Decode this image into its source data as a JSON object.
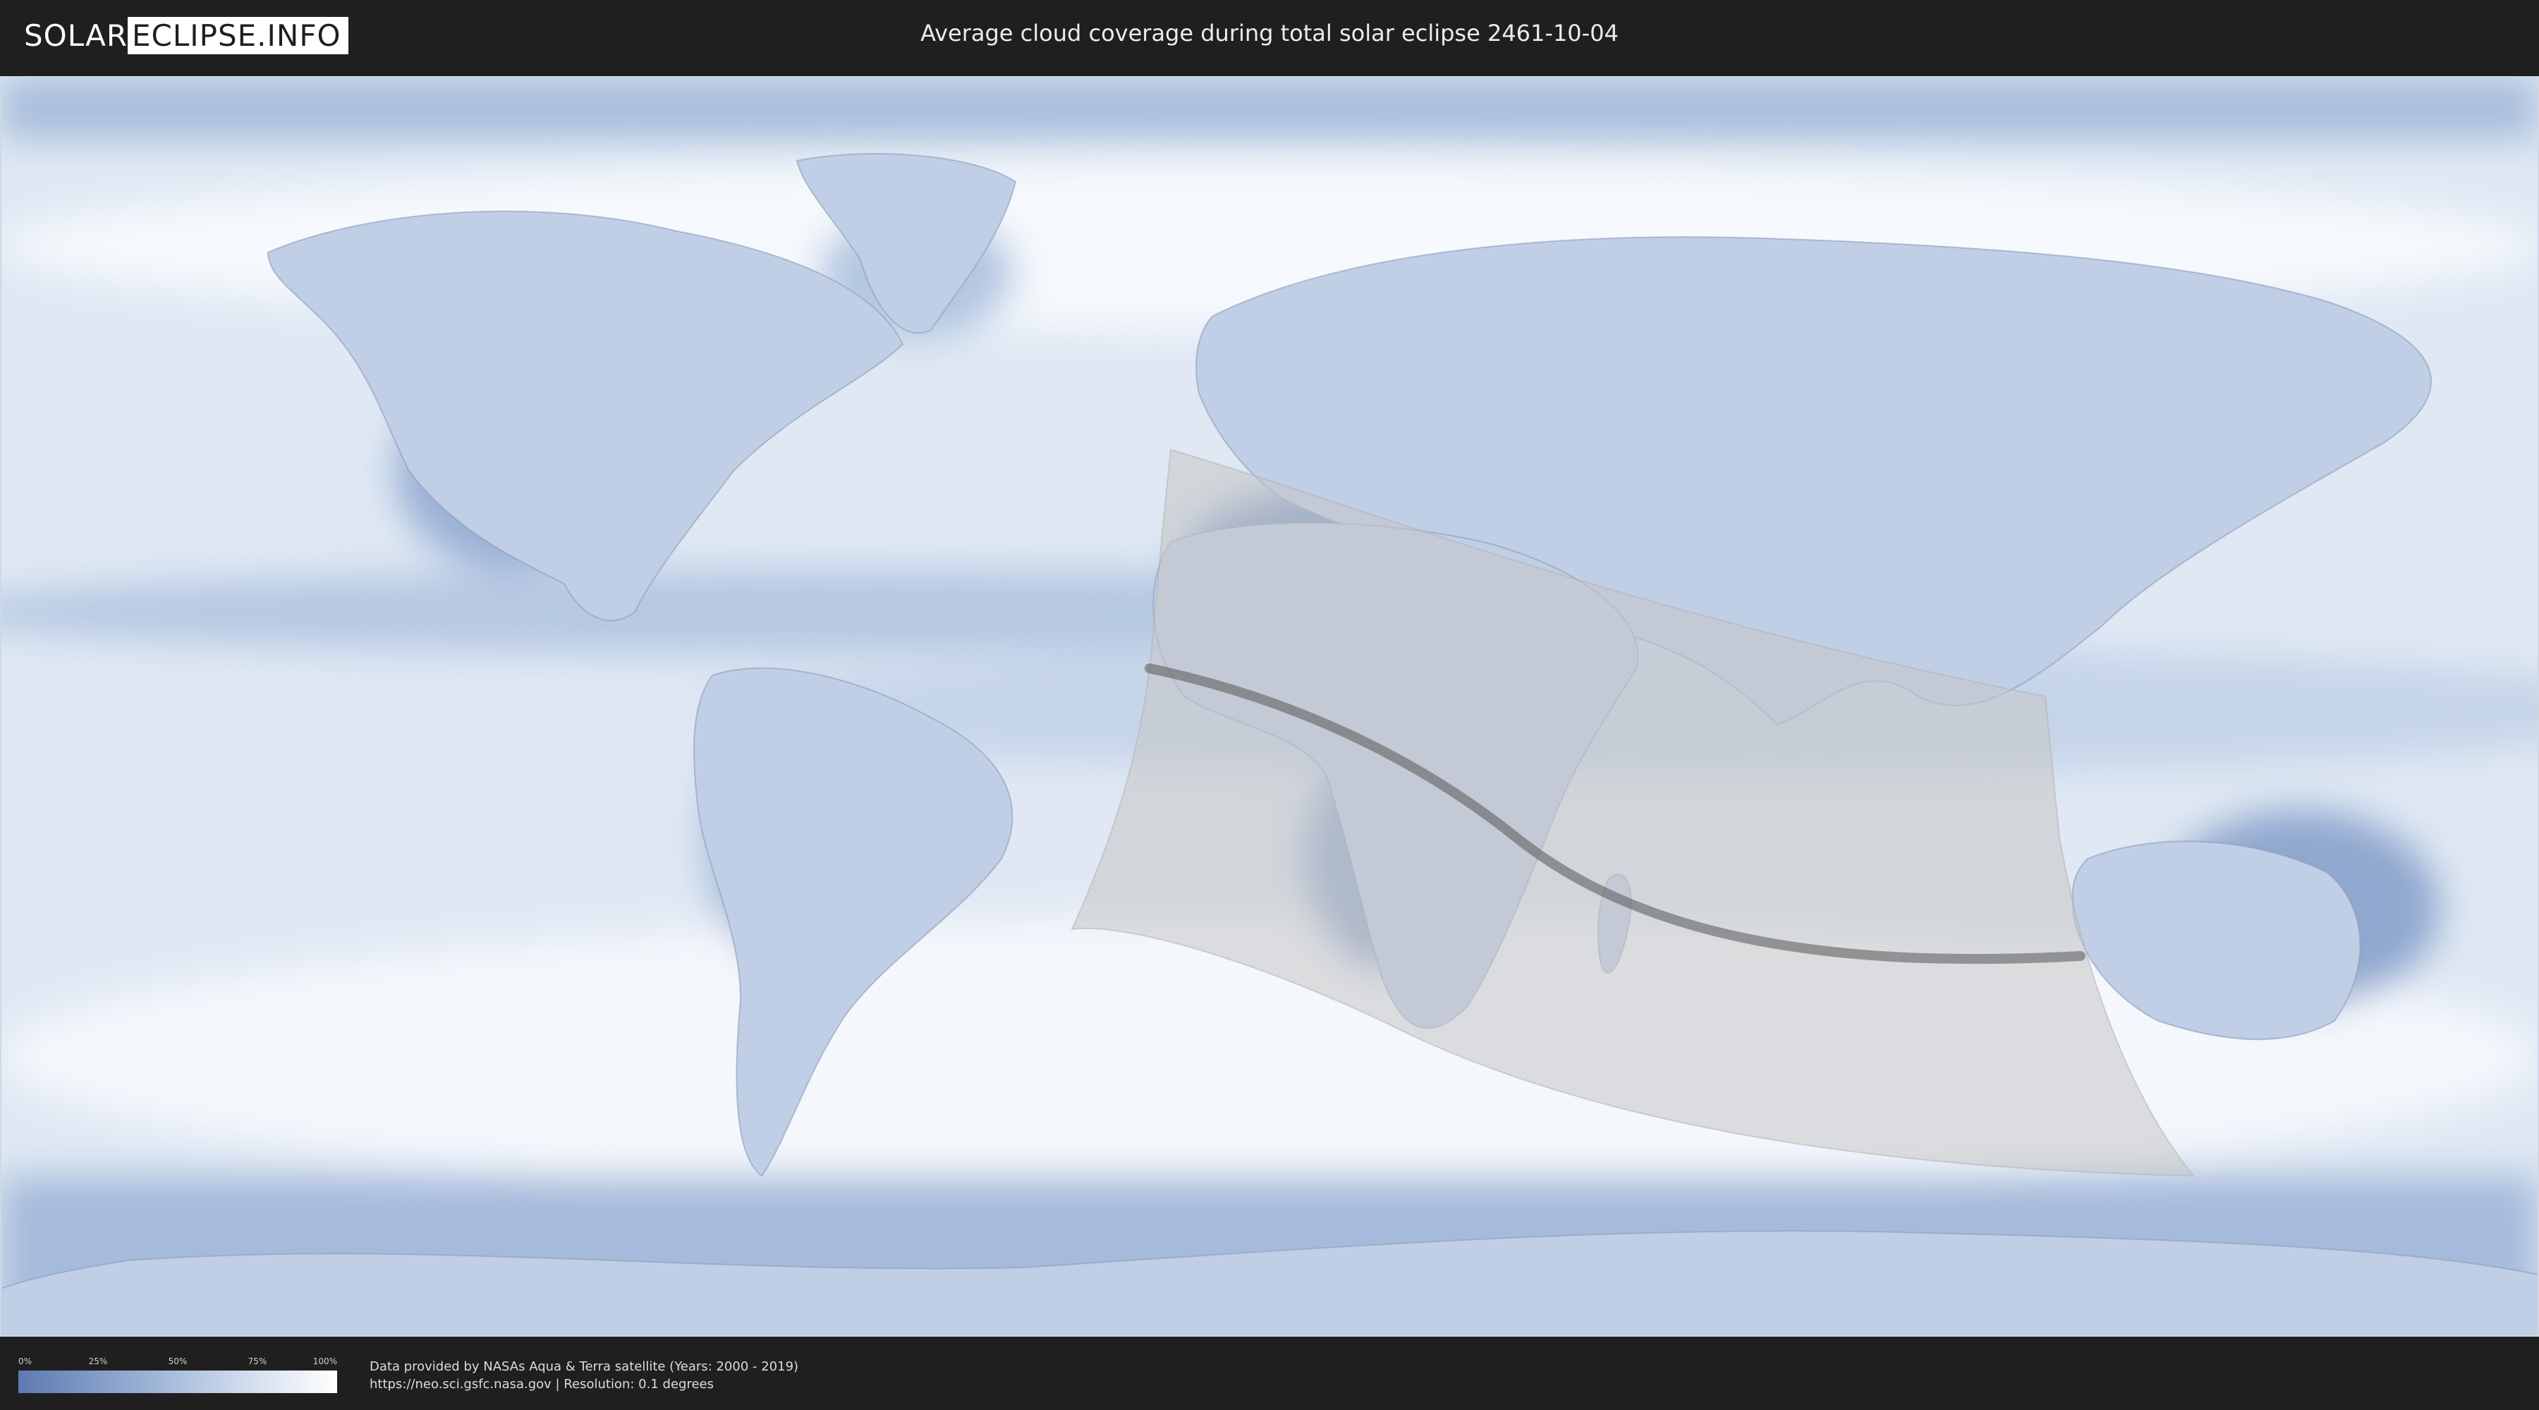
{
  "header": {
    "logo_left": "SOLAR",
    "logo_right": "ECLIPSE.INFO",
    "title": "Average cloud coverage during total solar eclipse 2461-10-04"
  },
  "legend": {
    "ticks": [
      "0%",
      "25%",
      "50%",
      "75%",
      "100%"
    ],
    "colors": {
      "low": "#5d7ab0",
      "high": "#ffffff"
    }
  },
  "footer": {
    "credit_line1": "Data provided by NASAs Aqua & Terra satellite (Years: 2000 - 2019)",
    "credit_line2": "https://neo.sci.gsfc.nasa.gov | Resolution: 0.1 degrees"
  },
  "map": {
    "projection": "equirectangular",
    "colors": {
      "cloud": "#ffffff",
      "clear": "#5e7db4",
      "eclipse_zone": "#bfbfbf",
      "central_line": "#555555"
    }
  }
}
